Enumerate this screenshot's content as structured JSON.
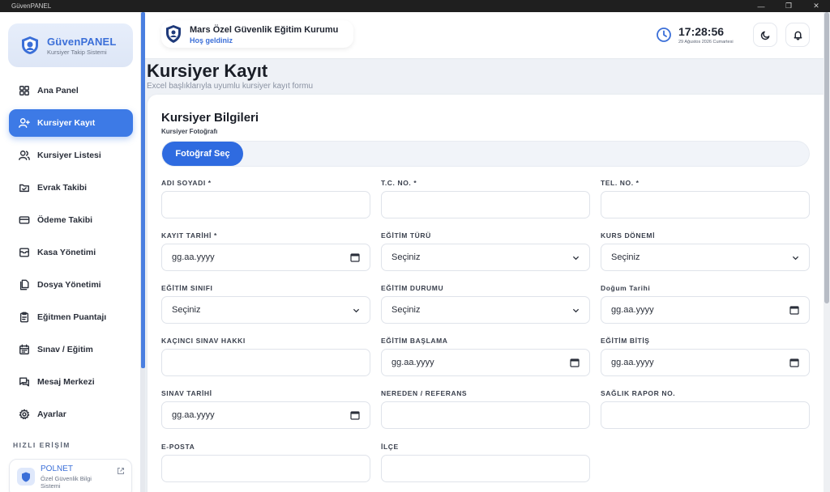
{
  "window": {
    "title": "GüvenPANEL",
    "controls": [
      "—",
      "❐",
      "✕"
    ]
  },
  "brand": {
    "title": "GüvenPANEL",
    "subtitle": "Kursiyer Takip Sistemi"
  },
  "nav": {
    "items": [
      {
        "label": "Ana Panel",
        "icon": "grid-icon",
        "active": false
      },
      {
        "label": "Kursiyer Kayıt",
        "icon": "user-plus-icon",
        "active": true
      },
      {
        "label": "Kursiyer Listesi",
        "icon": "users-icon",
        "active": false
      },
      {
        "label": "Evrak Takibi",
        "icon": "folder-check-icon",
        "active": false
      },
      {
        "label": "Ödeme Takibi",
        "icon": "credit-card-icon",
        "active": false
      },
      {
        "label": "Kasa Yönetimi",
        "icon": "archive-icon",
        "active": false
      },
      {
        "label": "Dosya Yönetimi",
        "icon": "files-icon",
        "active": false
      },
      {
        "label": "Eğitmen Puantajı",
        "icon": "clipboard-icon",
        "active": false
      },
      {
        "label": "Sınav / Eğitim",
        "icon": "calendar-icon",
        "active": false
      },
      {
        "label": "Mesaj Merkezi",
        "icon": "message-icon",
        "active": false
      },
      {
        "label": "Ayarlar",
        "icon": "gear-icon",
        "active": false
      }
    ]
  },
  "quick_access": {
    "title": "HIZLI ERİŞİM",
    "polnet": {
      "title": "POLNET",
      "subtitle": "Özel Güvenlik Bilgi Sistemi"
    }
  },
  "header": {
    "org_name": "Mars Özel Güvenlik Eğitim Kurumu",
    "welcome": "Hoş geldiniz",
    "time": "17:28:56",
    "date": "29 Ağustos 2026 Cumartesi"
  },
  "page": {
    "title": "Kursiyer Kayıt",
    "subtitle": "Excel başlıklarıyla uyumlu kursiyer kayıt formu"
  },
  "form": {
    "card_title": "Kursiyer Bilgileri",
    "photo_label": "Kursiyer Fotoğrafı",
    "photo_button": "Fotoğraf Seç",
    "fields": [
      {
        "label": "ADI SOYADI *",
        "type": "text",
        "value": ""
      },
      {
        "label": "T.C. NO. *",
        "type": "text",
        "value": ""
      },
      {
        "label": "TEL. NO. *",
        "type": "text",
        "value": ""
      },
      {
        "label": "KAYIT TARİHİ *",
        "type": "date",
        "value": "gg.aa.yyyy"
      },
      {
        "label": "EĞİTİM TÜRÜ",
        "type": "select",
        "value": "Seçiniz"
      },
      {
        "label": "KURS DÖNEMİ",
        "type": "select",
        "value": "Seçiniz"
      },
      {
        "label": "EĞİTİM SINIFI",
        "type": "select",
        "value": "Seçiniz"
      },
      {
        "label": "EĞİTİM DURUMU",
        "type": "select",
        "value": "Seçiniz"
      },
      {
        "label": "Doğum Tarihi",
        "type": "date",
        "value": "gg.aa.yyyy"
      },
      {
        "label": "KAÇINCI SINAV HAKKI",
        "type": "text",
        "value": ""
      },
      {
        "label": "EĞİTİM BAŞLAMA",
        "type": "date",
        "value": "gg.aa.yyyy"
      },
      {
        "label": "EĞİTİM BİTİŞ",
        "type": "date",
        "value": "gg.aa.yyyy"
      },
      {
        "label": "SINAV TARİHİ",
        "type": "date",
        "value": "gg.aa.yyyy"
      },
      {
        "label": "NEREDEN / REFERANS",
        "type": "text",
        "value": ""
      },
      {
        "label": "SAĞLIK RAPOR NO.",
        "type": "text",
        "value": ""
      },
      {
        "label": "E-POSTA",
        "type": "text",
        "value": ""
      },
      {
        "label": "İLÇE",
        "type": "text",
        "value": ""
      }
    ]
  },
  "colors": {
    "accent": "#3d7ae6",
    "brand_text": "#3b6fd8",
    "background": "#eef1f6"
  }
}
